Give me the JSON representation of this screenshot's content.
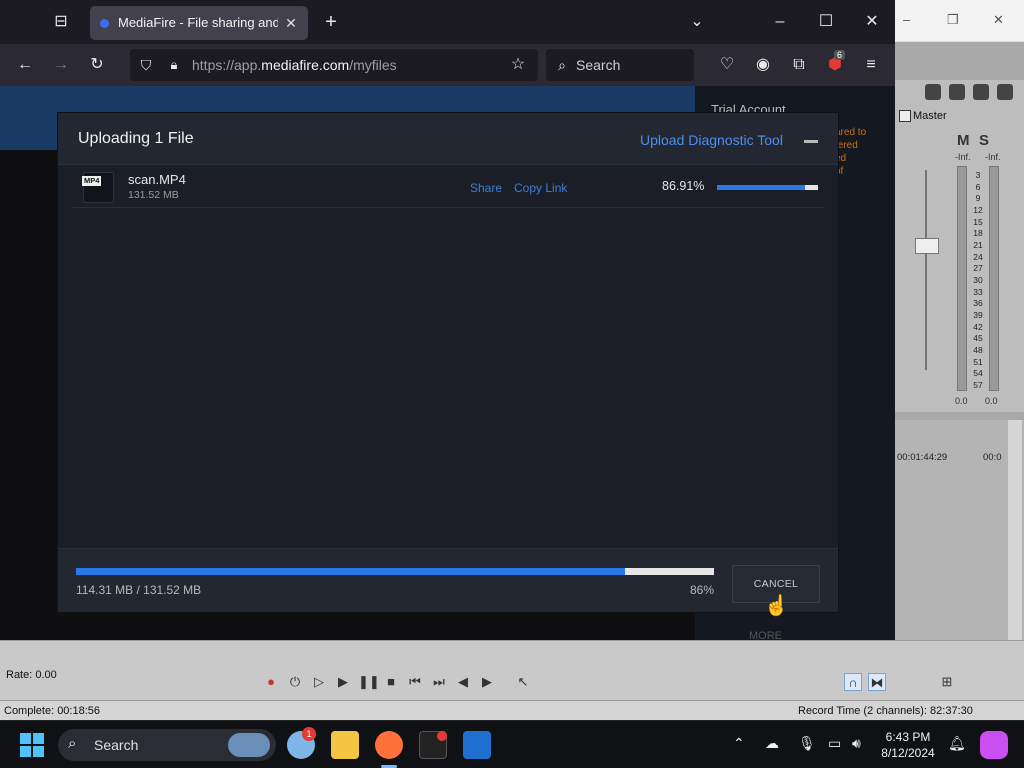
{
  "browser": {
    "tab_title": "MediaFire - File sharing and sto",
    "url_prefix": "https://app.",
    "url_domain": "mediafire.com",
    "url_path": "/myfiles",
    "search_label": "Search",
    "extension_badge": "6",
    "icons": [
      "tab-list-icon",
      "close-icon",
      "new-tab-icon",
      "chevron-down-icon",
      "minimize-icon",
      "maximize-icon",
      "back-icon",
      "forward-icon",
      "reload-icon",
      "shield-icon",
      "lock-icon",
      "star-icon",
      "search-icon",
      "pocket-icon",
      "account-icon",
      "extensions-icon",
      "ublock-icon",
      "menu-icon"
    ]
  },
  "page": {
    "trial_account": "Trial Account",
    "side_text_lines": [
      "ared to",
      "tered",
      "ed",
      "of"
    ],
    "more_label": "MORE"
  },
  "modal": {
    "title": "Uploading 1 File",
    "diagnostic_link": "Upload Diagnostic Tool",
    "files": [
      {
        "type_tag": "MP4",
        "name": "scan.MP4",
        "size": "131.52 MB",
        "share_label": "Share",
        "copy_link_label": "Copy Link",
        "percent_text": "86.91%",
        "progress": 0.8691
      }
    ],
    "total": {
      "transferred_text": "114.31 MB / 131.52 MB",
      "percent_text": "86%",
      "progress": 0.86
    },
    "cancel_label": "CANCEL"
  },
  "background_app": {
    "title_buttons": [
      "–",
      "❐",
      "✕"
    ],
    "mixer": {
      "master_label": "Master",
      "mute_label": "M",
      "solo_label": "S",
      "inf_left": "-Inf.",
      "inf_right": "-Inf.",
      "meter_scale": [
        "3",
        "6",
        "9",
        "12",
        "15",
        "18",
        "21",
        "24",
        "27",
        "30",
        "33",
        "36",
        "39",
        "42",
        "45",
        "48",
        "51",
        "54",
        "57"
      ],
      "value_left": "0.0",
      "value_right": "0.0"
    },
    "timeline": {
      "time_1": "00:01:44:29",
      "time_2": "00:0"
    },
    "transport": {
      "rate_label": "Rate: 0.00"
    },
    "status": {
      "complete_text": "Complete: 00:18:56",
      "record_time_text": "Record Time (2 channels): 82:37:30"
    }
  },
  "taskbar": {
    "search_label": "Search",
    "weather_badge": "1",
    "time": "6:43 PM",
    "date": "8/12/2024",
    "apps": [
      "weather-icon",
      "file-explorer-icon",
      "firefox-icon",
      "app-icon",
      "vegas-icon"
    ],
    "colors": {
      "start": "#4fc3f7",
      "firefox": "#ff7139",
      "folder": "#f4c542"
    }
  }
}
